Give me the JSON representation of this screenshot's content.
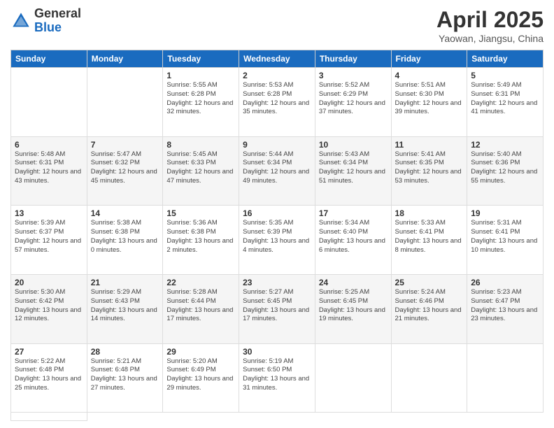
{
  "header": {
    "logo_general": "General",
    "logo_blue": "Blue",
    "title": "April 2025",
    "subtitle": "Yaowan, Jiangsu, China"
  },
  "weekdays": [
    "Sunday",
    "Monday",
    "Tuesday",
    "Wednesday",
    "Thursday",
    "Friday",
    "Saturday"
  ],
  "days": [
    {
      "date": null
    },
    {
      "date": null
    },
    {
      "date": "1",
      "sunrise": "Sunrise: 5:55 AM",
      "sunset": "Sunset: 6:28 PM",
      "daylight": "Daylight: 12 hours and 32 minutes."
    },
    {
      "date": "2",
      "sunrise": "Sunrise: 5:53 AM",
      "sunset": "Sunset: 6:28 PM",
      "daylight": "Daylight: 12 hours and 35 minutes."
    },
    {
      "date": "3",
      "sunrise": "Sunrise: 5:52 AM",
      "sunset": "Sunset: 6:29 PM",
      "daylight": "Daylight: 12 hours and 37 minutes."
    },
    {
      "date": "4",
      "sunrise": "Sunrise: 5:51 AM",
      "sunset": "Sunset: 6:30 PM",
      "daylight": "Daylight: 12 hours and 39 minutes."
    },
    {
      "date": "5",
      "sunrise": "Sunrise: 5:49 AM",
      "sunset": "Sunset: 6:31 PM",
      "daylight": "Daylight: 12 hours and 41 minutes."
    },
    {
      "date": "6",
      "sunrise": "Sunrise: 5:48 AM",
      "sunset": "Sunset: 6:31 PM",
      "daylight": "Daylight: 12 hours and 43 minutes."
    },
    {
      "date": "7",
      "sunrise": "Sunrise: 5:47 AM",
      "sunset": "Sunset: 6:32 PM",
      "daylight": "Daylight: 12 hours and 45 minutes."
    },
    {
      "date": "8",
      "sunrise": "Sunrise: 5:45 AM",
      "sunset": "Sunset: 6:33 PM",
      "daylight": "Daylight: 12 hours and 47 minutes."
    },
    {
      "date": "9",
      "sunrise": "Sunrise: 5:44 AM",
      "sunset": "Sunset: 6:34 PM",
      "daylight": "Daylight: 12 hours and 49 minutes."
    },
    {
      "date": "10",
      "sunrise": "Sunrise: 5:43 AM",
      "sunset": "Sunset: 6:34 PM",
      "daylight": "Daylight: 12 hours and 51 minutes."
    },
    {
      "date": "11",
      "sunrise": "Sunrise: 5:41 AM",
      "sunset": "Sunset: 6:35 PM",
      "daylight": "Daylight: 12 hours and 53 minutes."
    },
    {
      "date": "12",
      "sunrise": "Sunrise: 5:40 AM",
      "sunset": "Sunset: 6:36 PM",
      "daylight": "Daylight: 12 hours and 55 minutes."
    },
    {
      "date": "13",
      "sunrise": "Sunrise: 5:39 AM",
      "sunset": "Sunset: 6:37 PM",
      "daylight": "Daylight: 12 hours and 57 minutes."
    },
    {
      "date": "14",
      "sunrise": "Sunrise: 5:38 AM",
      "sunset": "Sunset: 6:38 PM",
      "daylight": "Daylight: 13 hours and 0 minutes."
    },
    {
      "date": "15",
      "sunrise": "Sunrise: 5:36 AM",
      "sunset": "Sunset: 6:38 PM",
      "daylight": "Daylight: 13 hours and 2 minutes."
    },
    {
      "date": "16",
      "sunrise": "Sunrise: 5:35 AM",
      "sunset": "Sunset: 6:39 PM",
      "daylight": "Daylight: 13 hours and 4 minutes."
    },
    {
      "date": "17",
      "sunrise": "Sunrise: 5:34 AM",
      "sunset": "Sunset: 6:40 PM",
      "daylight": "Daylight: 13 hours and 6 minutes."
    },
    {
      "date": "18",
      "sunrise": "Sunrise: 5:33 AM",
      "sunset": "Sunset: 6:41 PM",
      "daylight": "Daylight: 13 hours and 8 minutes."
    },
    {
      "date": "19",
      "sunrise": "Sunrise: 5:31 AM",
      "sunset": "Sunset: 6:41 PM",
      "daylight": "Daylight: 13 hours and 10 minutes."
    },
    {
      "date": "20",
      "sunrise": "Sunrise: 5:30 AM",
      "sunset": "Sunset: 6:42 PM",
      "daylight": "Daylight: 13 hours and 12 minutes."
    },
    {
      "date": "21",
      "sunrise": "Sunrise: 5:29 AM",
      "sunset": "Sunset: 6:43 PM",
      "daylight": "Daylight: 13 hours and 14 minutes."
    },
    {
      "date": "22",
      "sunrise": "Sunrise: 5:28 AM",
      "sunset": "Sunset: 6:44 PM",
      "daylight": "Daylight: 13 hours and 17 minutes."
    },
    {
      "date": "23",
      "sunrise": "Sunrise: 5:27 AM",
      "sunset": "Sunset: 6:45 PM",
      "daylight": "Daylight: 13 hours and 17 minutes."
    },
    {
      "date": "24",
      "sunrise": "Sunrise: 5:25 AM",
      "sunset": "Sunset: 6:45 PM",
      "daylight": "Daylight: 13 hours and 19 minutes."
    },
    {
      "date": "25",
      "sunrise": "Sunrise: 5:24 AM",
      "sunset": "Sunset: 6:46 PM",
      "daylight": "Daylight: 13 hours and 21 minutes."
    },
    {
      "date": "26",
      "sunrise": "Sunrise: 5:23 AM",
      "sunset": "Sunset: 6:47 PM",
      "daylight": "Daylight: 13 hours and 23 minutes."
    },
    {
      "date": "27",
      "sunrise": "Sunrise: 5:22 AM",
      "sunset": "Sunset: 6:48 PM",
      "daylight": "Daylight: 13 hours and 25 minutes."
    },
    {
      "date": "28",
      "sunrise": "Sunrise: 5:21 AM",
      "sunset": "Sunset: 6:48 PM",
      "daylight": "Daylight: 13 hours and 27 minutes."
    },
    {
      "date": "29",
      "sunrise": "Sunrise: 5:20 AM",
      "sunset": "Sunset: 6:49 PM",
      "daylight": "Daylight: 13 hours and 29 minutes."
    },
    {
      "date": "30",
      "sunrise": "Sunrise: 5:19 AM",
      "sunset": "Sunset: 6:50 PM",
      "daylight": "Daylight: 13 hours and 31 minutes."
    },
    {
      "date": null
    },
    {
      "date": null
    },
    {
      "date": null
    },
    {
      "date": null
    }
  ]
}
